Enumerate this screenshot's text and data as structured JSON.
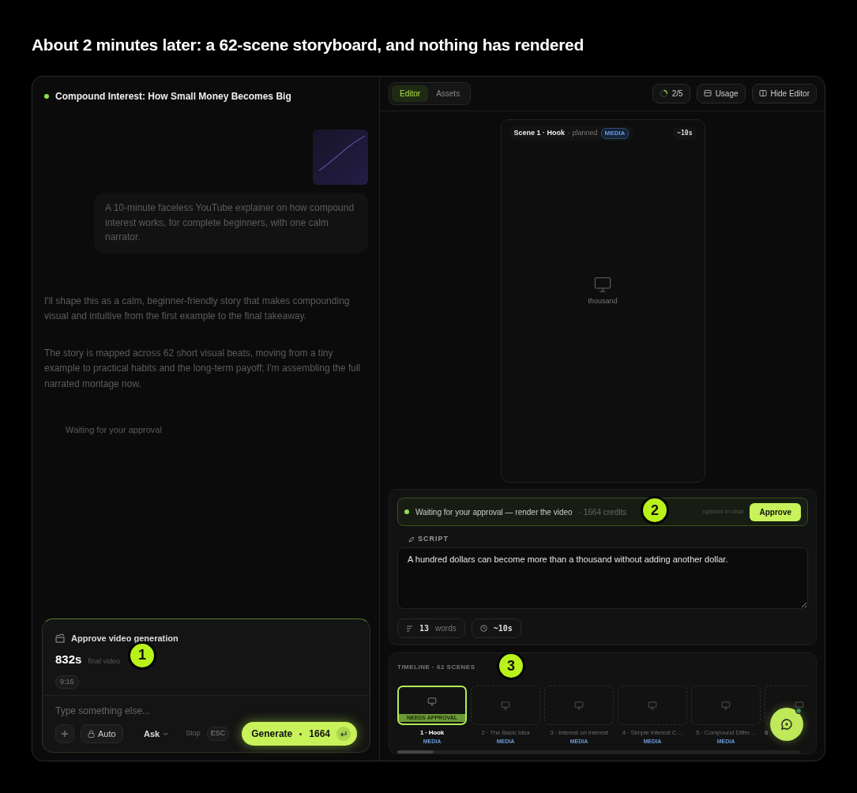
{
  "heading": "About 2 minutes later: a 62-scene storyboard, and nothing has rendered",
  "chat": {
    "title": "Compound Interest: How Small Money Becomes Big",
    "user_message": "A 10-minute faceless YouTube explainer on how compound interest works, for complete beginners, with one calm narrator.",
    "assistant_messages": [
      "I'll shape this as a calm, beginner-friendly story that makes compounding visual and intuitive from the first example to the final takeaway.",
      "The story is mapped across 62 short visual beats, moving from a tiny example to practical habits and the long-term payoff; I'm assembling the full narrated montage now."
    ],
    "waiting": "Waiting for your approval"
  },
  "composer": {
    "title": "Approve video generation",
    "duration": "832s",
    "duration_label": "final video",
    "aspect": "9:16",
    "placeholder": "Type something else...",
    "mode": "Auto",
    "ask": "Ask",
    "stop": "Stop",
    "stop_key": "ESC",
    "generate": "Generate",
    "credits": "1664"
  },
  "editor": {
    "tabs": [
      {
        "label": "Editor",
        "selected": true
      },
      {
        "label": "Assets",
        "selected": false
      }
    ],
    "progress": "2/5",
    "usage": "Usage",
    "hide": "Hide Editor"
  },
  "preview": {
    "scene": "Scene 1 · Hook",
    "status": "· planned",
    "badge": "MEDIA",
    "duration": "~10s",
    "caption": "thousand"
  },
  "approval": {
    "text": "Waiting for your approval — render the video",
    "credits": "· 1664 credits",
    "hint": "options in chat",
    "button": "Approve"
  },
  "script": {
    "label": "SCRIPT",
    "text": "A hundred dollars can become more than a thousand without adding another dollar.",
    "words_count": "13",
    "words_label": "words",
    "duration": "~10s"
  },
  "timeline": {
    "title": "TIMELINE · 62 SCENES",
    "scenes": [
      {
        "title": "1 · Hook",
        "badge": "MEDIA",
        "selected": true,
        "status": "NEEDS APPROVAL"
      },
      {
        "title": "2 · The Basic Idea",
        "badge": "MEDIA",
        "selected": false
      },
      {
        "title": "3 · Interest on Interest",
        "badge": "MEDIA",
        "selected": false
      },
      {
        "title": "4 · Simple Interest C…",
        "badge": "MEDIA",
        "selected": false
      },
      {
        "title": "5 · Compound Differ…",
        "badge": "MEDIA",
        "selected": false
      },
      {
        "title": "6",
        "selected": false
      }
    ]
  },
  "callouts": [
    "1",
    "2",
    "3"
  ]
}
